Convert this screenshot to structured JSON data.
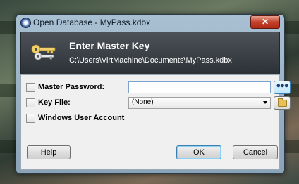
{
  "window": {
    "title": "Open Database - MyPass.kdbx",
    "close_label": "✕"
  },
  "banner": {
    "title": "Enter Master Key",
    "path": "C:\\Users\\VirtMachine\\Documents\\MyPass.kdbx",
    "icon": "keys-icon"
  },
  "fields": {
    "master_password": {
      "label": "Master Password:",
      "checked": false,
      "value": "",
      "reveal_button": "●●●"
    },
    "key_file": {
      "label": "Key File:",
      "checked": false,
      "selected": "(None)",
      "browse_icon": "folder-icon"
    },
    "windows_account": {
      "label": "Windows User Account",
      "checked": false
    }
  },
  "buttons": {
    "help": "Help",
    "ok": "OK",
    "cancel": "Cancel"
  },
  "colors": {
    "banner_bg": "#3a4046",
    "accent": "#3c7fb1",
    "close_red": "#c3402a"
  }
}
